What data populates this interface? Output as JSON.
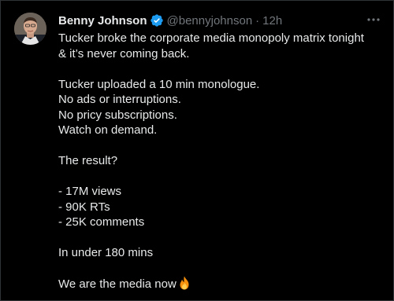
{
  "tweet": {
    "author_name": "Benny Johnson",
    "handle": "@bennyjohnson",
    "separator": "·",
    "time": "12h",
    "lines": [
      "Tucker broke the corporate media monopoly matrix tonight",
      "& it’s never coming back.",
      "",
      "Tucker uploaded a 10 min monologue.",
      "No ads or interruptions.",
      "No pricy subscriptions.",
      "Watch on demand.",
      "",
      "The result?",
      "",
      "- 17M views",
      "- 90K RTs",
      "- 25K comments",
      "",
      "In under 180 mins",
      "",
      "We are the media now"
    ],
    "end_emoji": "fire-emoji"
  },
  "icons": {
    "verified": "verified-badge-icon",
    "more": "more-horizontal-icon"
  },
  "colors": {
    "background": "#000000",
    "text": "#e7e9ea",
    "muted": "#71767b",
    "verified": "#1d9bf0",
    "border": "#2f3336"
  }
}
